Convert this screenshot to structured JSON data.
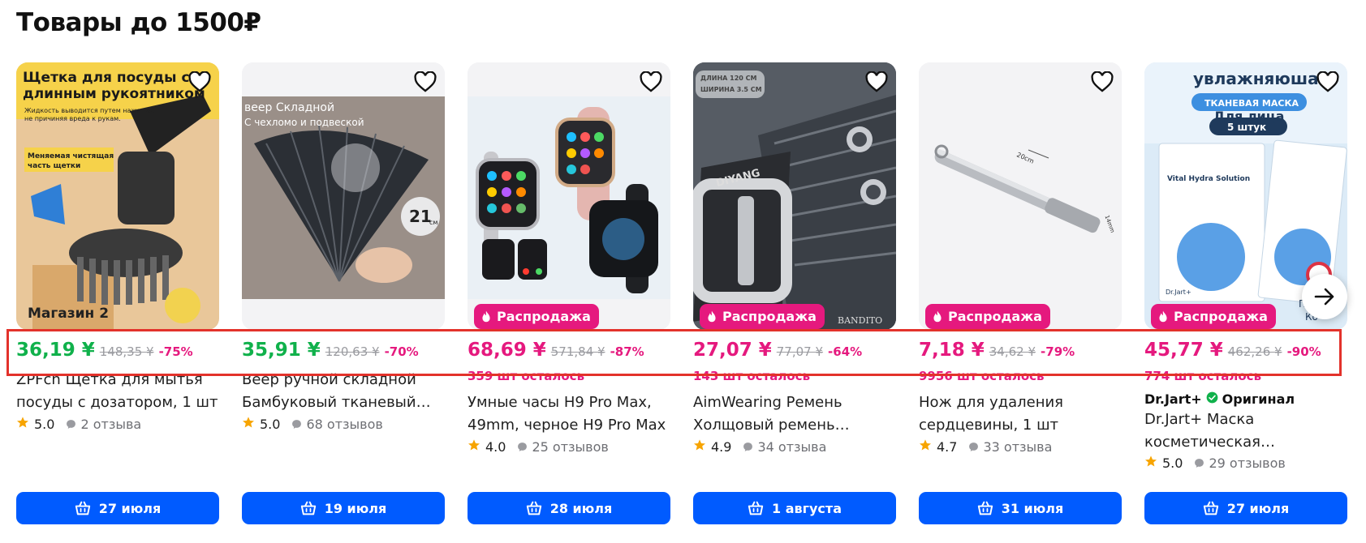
{
  "section": {
    "title": "Товары до 1500₽"
  },
  "colors": {
    "accent": "#005bff",
    "sale": "#e5197e",
    "green_price": "#10b14b",
    "highlight": "#e3322b"
  },
  "cards": [
    {
      "price": "36,19 ¥",
      "old_price": "148,35 ¥",
      "discount": "-75%",
      "price_color": "green",
      "badge": "",
      "stock": "",
      "brand": "",
      "brand_badge": "",
      "title": "ZPFcn Щетка для мытья посуды с дозатором, 1 шт",
      "rating": "5.0",
      "reviews": "2 отзыва",
      "delivery": "27 июля",
      "image_text": [
        "Щетка для посуды с",
        "длинным рукоятником",
        "Жидкость выводится путем нажатия,",
        "не причиняя вреда к рукам.",
        "Меняемая чистящая",
        "часть щетки"
      ],
      "shop": "Магазин 2"
    },
    {
      "price": "35,91 ¥",
      "old_price": "120,63 ¥",
      "discount": "-70%",
      "price_color": "green",
      "badge": "",
      "stock": "",
      "brand": "",
      "brand_badge": "",
      "title": "Веер ручной складной Бамбуковый тканевый…",
      "rating": "5.0",
      "reviews": "68 отзывов",
      "delivery": "19 июля",
      "image_text": [
        "веер Складной",
        "С чехломо и подвеской",
        "21",
        "см"
      ]
    },
    {
      "price": "68,69 ¥",
      "old_price": "571,84 ¥",
      "discount": "-87%",
      "price_color": "pink",
      "badge": "Распродажа",
      "stock": "359 шт осталось",
      "brand": "",
      "brand_badge": "",
      "title": "Умные часы H9 Pro Max, 49mm, черное H9 Pro Max",
      "rating": "4.0",
      "reviews": "25 отзывов",
      "delivery": "28 июля"
    },
    {
      "price": "27,07 ¥",
      "old_price": "77,07 ¥",
      "discount": "-64%",
      "price_color": "pink",
      "badge": "Распродажа",
      "stock": "143 шт осталось",
      "brand": "",
      "brand_badge": "",
      "title": "AimWearing Ремень Холщовый ремень длино…",
      "rating": "4.9",
      "reviews": "34 отзыва",
      "delivery": "1 августа",
      "image_text": [
        "ДЛИНА 120 СМ",
        "ШИРИНА 3.5 СМ",
        "DIYANG",
        "BANDITO"
      ]
    },
    {
      "price": "7,18 ¥",
      "old_price": "34,62 ¥",
      "discount": "-79%",
      "price_color": "pink",
      "badge": "Распродажа",
      "stock": "9956 шт осталось",
      "brand": "",
      "brand_badge": "",
      "title": "Нож для удаления сердцевины, 1 шт",
      "rating": "4.7",
      "reviews": "33 отзыва",
      "delivery": "31 июля",
      "image_text": [
        "20cm",
        "14mm"
      ]
    },
    {
      "price": "45,77 ¥",
      "old_price": "462,26 ¥",
      "discount": "-90%",
      "price_color": "pink",
      "badge": "Распродажа",
      "stock": "774 шт осталось",
      "brand": "Dr.Jart+",
      "brand_badge": "Оригинал",
      "title": "Dr.Jart+ Маска косметическая…",
      "rating": "5.0",
      "reviews": "29 отзывов",
      "delivery": "27 июля",
      "image_text": [
        "увлажняюшая",
        "ТКАНЕВАЯ МАСКА",
        "Для лица",
        "5 штук",
        "Vital Hydra Solution",
        "Dr.Jart+",
        "Прои",
        "Ко"
      ]
    }
  ]
}
